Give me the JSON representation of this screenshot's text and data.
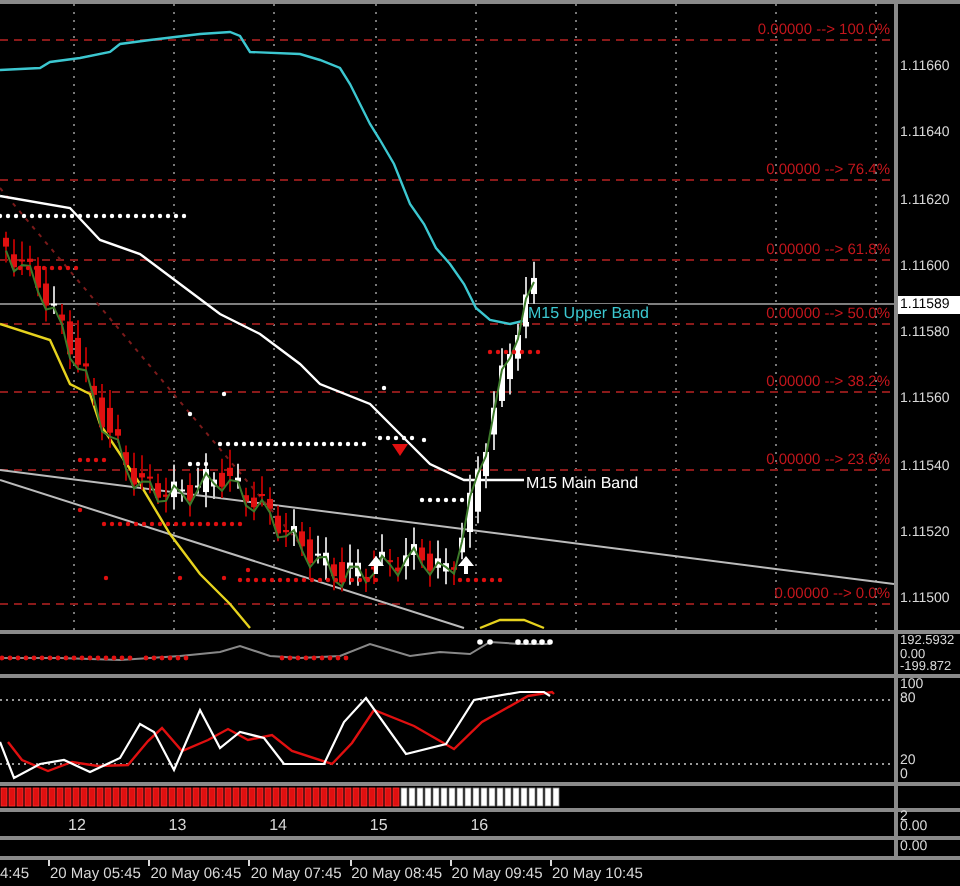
{
  "price_axis": {
    "labels": [
      "1.11660",
      "1.11640",
      "1.11620",
      "1.11600",
      "1.11580",
      "1.11560",
      "1.11540",
      "1.11520",
      "1.11500"
    ],
    "current_price": "1.11589"
  },
  "fib_levels": [
    {
      "label": "0.00000 --> 100.0%"
    },
    {
      "label": "0.00000 --> 76.4%"
    },
    {
      "label": "0.00000 --> 61.8%"
    },
    {
      "label": "0.00000 --> 50.0%"
    },
    {
      "label": "0.00000 --> 38.2%"
    },
    {
      "label": "0.00000 --> 23.6%"
    },
    {
      "label": "0.00000 --> 0.0%"
    }
  ],
  "band_labels": [
    "M15 Upper Band",
    "M15 Main Band"
  ],
  "oscillator_panel": {
    "labels": [
      "192.5932",
      "0.00",
      "-199.872"
    ]
  },
  "stochastic_panel": {
    "labels": [
      "100",
      "80",
      "20",
      "0"
    ]
  },
  "day_panel": {
    "days": [
      "12",
      "13",
      "14",
      "15",
      "16"
    ],
    "labels": [
      "2",
      "0.00"
    ]
  },
  "bottom_panel": {
    "labels": [
      "0.00"
    ]
  },
  "time_axis": [
    "4:45",
    "20 May 05:45",
    "20 May 06:45",
    "20 May 07:45",
    "20 May 08:45",
    "20 May 09:45",
    "20 May 10:45"
  ]
}
